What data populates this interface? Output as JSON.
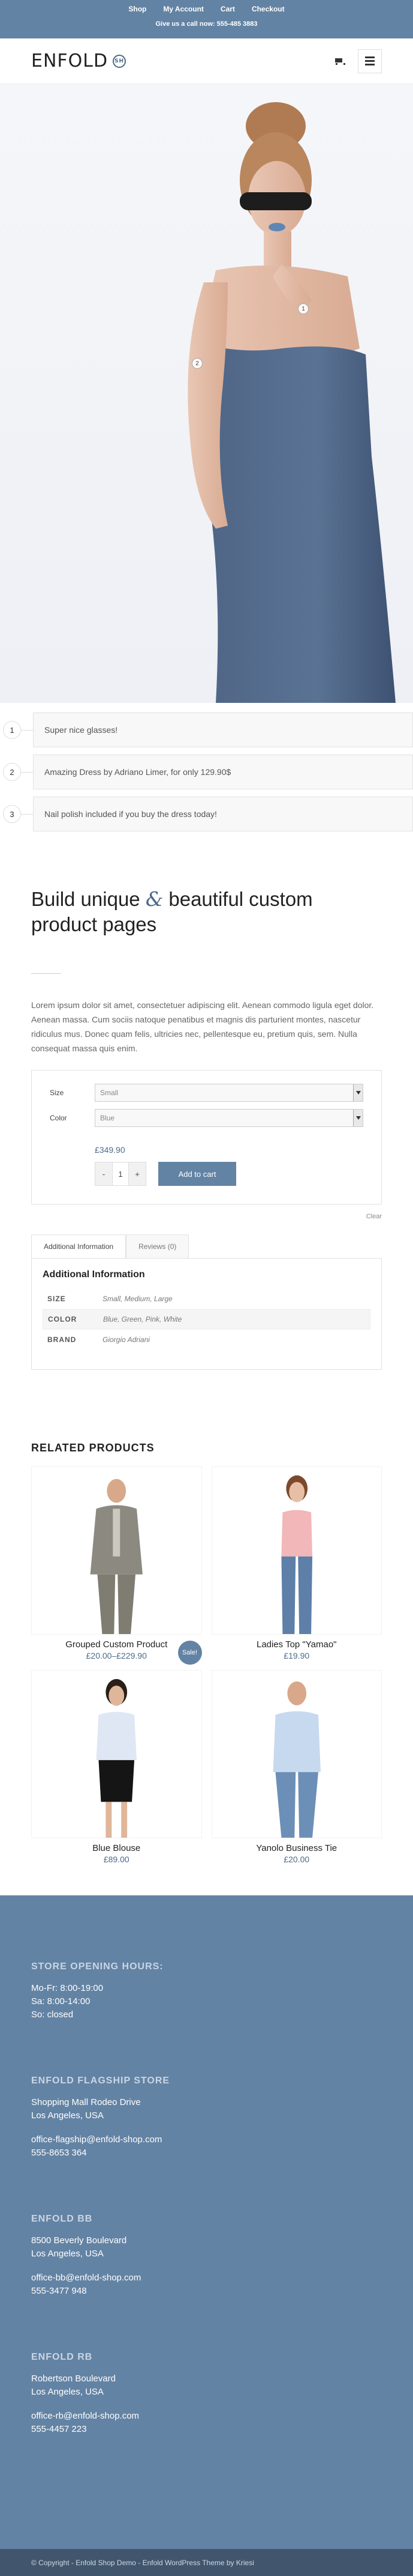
{
  "topbar": {
    "menu": [
      "Shop",
      "My Account",
      "Cart",
      "Checkout"
    ],
    "call": "Give us a call now: 555-485 3883"
  },
  "header": {
    "logo_text": "ENFOLD",
    "logo_badge": "SH"
  },
  "hero": {
    "hotspots": [
      "1",
      "2"
    ]
  },
  "notes": [
    {
      "num": "1",
      "text": "Super nice glasses!"
    },
    {
      "num": "2",
      "text": "Amazing Dress by Adriano Limer, for only 129.90$"
    },
    {
      "num": "3",
      "text": "Nail polish included if you buy the dress today!"
    }
  ],
  "product": {
    "title_part1": "Build unique",
    "title_amp": "&",
    "title_part2": "beautiful custom product pages",
    "description": "Lorem ipsum dolor sit amet, consectetuer adipiscing elit. Aenean commodo ligula eget dolor. Aenean massa. Cum sociis natoque penatibus et magnis dis parturient montes, nascetur ridiculus mus. Donec quam felis, ultricies nec, pellentesque eu, pretium quis, sem. Nulla consequat massa quis enim.",
    "size_label": "Size",
    "size_value": "Small",
    "color_label": "Color",
    "color_value": "Blue",
    "price": "£349.90",
    "qty_minus": "-",
    "qty_value": "1",
    "qty_plus": "+",
    "add_to_cart": "Add to cart",
    "clear": "Clear"
  },
  "tabs": {
    "tab1": "Additional Information",
    "tab2": "Reviews (0)",
    "heading": "Additional Information",
    "attributes": [
      {
        "k": "SIZE",
        "v": "Small, Medium, Large"
      },
      {
        "k": "COLOR",
        "v": "Blue, Green, Pink, White"
      },
      {
        "k": "BRAND",
        "v": "Giorgio Adriani"
      }
    ]
  },
  "related": {
    "heading": "RELATED PRODUCTS",
    "products": [
      {
        "name": "Grouped Custom Product",
        "price": "£20.00–£229.90",
        "sale": "Sale!"
      },
      {
        "name": "Ladies Top \"Yamao\"",
        "price": "£19.90"
      },
      {
        "name": "Blue Blouse",
        "price": "£89.00"
      },
      {
        "name": "Yanolo Business Tie",
        "price": "£20.00"
      }
    ]
  },
  "footer": {
    "blocks": [
      {
        "title": "STORE OPENING HOURS:",
        "lines": [
          "Mo-Fr: 8:00-19:00",
          "Sa: 8:00-14:00",
          "So: closed"
        ],
        "extra": []
      },
      {
        "title": "ENFOLD FLAGSHIP STORE",
        "lines": [
          "Shopping Mall Rodeo Drive",
          "Los Angeles, USA"
        ],
        "extra": [
          "office-flagship@enfold-shop.com",
          "555-8653 364"
        ]
      },
      {
        "title": "ENFOLD BB",
        "lines": [
          "8500 Beverly Boulevard",
          "Los Angeles, USA"
        ],
        "extra": [
          "office-bb@enfold-shop.com",
          "555-3477 948"
        ]
      },
      {
        "title": "ENFOLD RB",
        "lines": [
          "Robertson Boulevard",
          "Los Angeles, USA"
        ],
        "extra": [
          "office-rb@enfold-shop.com",
          "555-4457 223"
        ]
      }
    ],
    "copyright": "© Copyright - Enfold Shop Demo - Enfold WordPress Theme by Kriesi"
  },
  "colors": {
    "accent": "#6383a4",
    "dark": "#41566d"
  }
}
